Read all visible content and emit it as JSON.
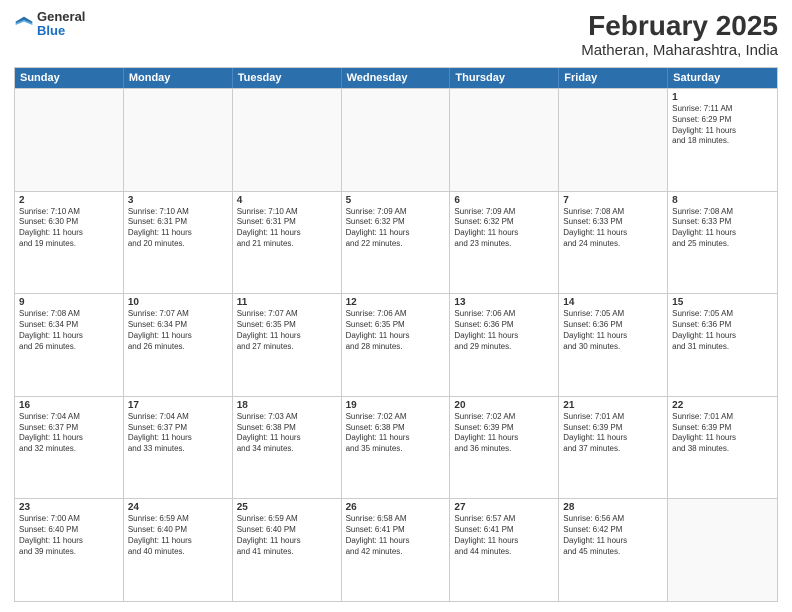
{
  "header": {
    "logo_general": "General",
    "logo_blue": "Blue",
    "main_title": "February 2025",
    "subtitle": "Matheran, Maharashtra, India"
  },
  "calendar": {
    "days_of_week": [
      "Sunday",
      "Monday",
      "Tuesday",
      "Wednesday",
      "Thursday",
      "Friday",
      "Saturday"
    ],
    "rows": [
      [
        {
          "day": "",
          "info": ""
        },
        {
          "day": "",
          "info": ""
        },
        {
          "day": "",
          "info": ""
        },
        {
          "day": "",
          "info": ""
        },
        {
          "day": "",
          "info": ""
        },
        {
          "day": "",
          "info": ""
        },
        {
          "day": "1",
          "info": "Sunrise: 7:11 AM\nSunset: 6:29 PM\nDaylight: 11 hours\nand 18 minutes."
        }
      ],
      [
        {
          "day": "2",
          "info": "Sunrise: 7:10 AM\nSunset: 6:30 PM\nDaylight: 11 hours\nand 19 minutes."
        },
        {
          "day": "3",
          "info": "Sunrise: 7:10 AM\nSunset: 6:31 PM\nDaylight: 11 hours\nand 20 minutes."
        },
        {
          "day": "4",
          "info": "Sunrise: 7:10 AM\nSunset: 6:31 PM\nDaylight: 11 hours\nand 21 minutes."
        },
        {
          "day": "5",
          "info": "Sunrise: 7:09 AM\nSunset: 6:32 PM\nDaylight: 11 hours\nand 22 minutes."
        },
        {
          "day": "6",
          "info": "Sunrise: 7:09 AM\nSunset: 6:32 PM\nDaylight: 11 hours\nand 23 minutes."
        },
        {
          "day": "7",
          "info": "Sunrise: 7:08 AM\nSunset: 6:33 PM\nDaylight: 11 hours\nand 24 minutes."
        },
        {
          "day": "8",
          "info": "Sunrise: 7:08 AM\nSunset: 6:33 PM\nDaylight: 11 hours\nand 25 minutes."
        }
      ],
      [
        {
          "day": "9",
          "info": "Sunrise: 7:08 AM\nSunset: 6:34 PM\nDaylight: 11 hours\nand 26 minutes."
        },
        {
          "day": "10",
          "info": "Sunrise: 7:07 AM\nSunset: 6:34 PM\nDaylight: 11 hours\nand 26 minutes."
        },
        {
          "day": "11",
          "info": "Sunrise: 7:07 AM\nSunset: 6:35 PM\nDaylight: 11 hours\nand 27 minutes."
        },
        {
          "day": "12",
          "info": "Sunrise: 7:06 AM\nSunset: 6:35 PM\nDaylight: 11 hours\nand 28 minutes."
        },
        {
          "day": "13",
          "info": "Sunrise: 7:06 AM\nSunset: 6:36 PM\nDaylight: 11 hours\nand 29 minutes."
        },
        {
          "day": "14",
          "info": "Sunrise: 7:05 AM\nSunset: 6:36 PM\nDaylight: 11 hours\nand 30 minutes."
        },
        {
          "day": "15",
          "info": "Sunrise: 7:05 AM\nSunset: 6:36 PM\nDaylight: 11 hours\nand 31 minutes."
        }
      ],
      [
        {
          "day": "16",
          "info": "Sunrise: 7:04 AM\nSunset: 6:37 PM\nDaylight: 11 hours\nand 32 minutes."
        },
        {
          "day": "17",
          "info": "Sunrise: 7:04 AM\nSunset: 6:37 PM\nDaylight: 11 hours\nand 33 minutes."
        },
        {
          "day": "18",
          "info": "Sunrise: 7:03 AM\nSunset: 6:38 PM\nDaylight: 11 hours\nand 34 minutes."
        },
        {
          "day": "19",
          "info": "Sunrise: 7:02 AM\nSunset: 6:38 PM\nDaylight: 11 hours\nand 35 minutes."
        },
        {
          "day": "20",
          "info": "Sunrise: 7:02 AM\nSunset: 6:39 PM\nDaylight: 11 hours\nand 36 minutes."
        },
        {
          "day": "21",
          "info": "Sunrise: 7:01 AM\nSunset: 6:39 PM\nDaylight: 11 hours\nand 37 minutes."
        },
        {
          "day": "22",
          "info": "Sunrise: 7:01 AM\nSunset: 6:39 PM\nDaylight: 11 hours\nand 38 minutes."
        }
      ],
      [
        {
          "day": "23",
          "info": "Sunrise: 7:00 AM\nSunset: 6:40 PM\nDaylight: 11 hours\nand 39 minutes."
        },
        {
          "day": "24",
          "info": "Sunrise: 6:59 AM\nSunset: 6:40 PM\nDaylight: 11 hours\nand 40 minutes."
        },
        {
          "day": "25",
          "info": "Sunrise: 6:59 AM\nSunset: 6:40 PM\nDaylight: 11 hours\nand 41 minutes."
        },
        {
          "day": "26",
          "info": "Sunrise: 6:58 AM\nSunset: 6:41 PM\nDaylight: 11 hours\nand 42 minutes."
        },
        {
          "day": "27",
          "info": "Sunrise: 6:57 AM\nSunset: 6:41 PM\nDaylight: 11 hours\nand 44 minutes."
        },
        {
          "day": "28",
          "info": "Sunrise: 6:56 AM\nSunset: 6:42 PM\nDaylight: 11 hours\nand 45 minutes."
        },
        {
          "day": "",
          "info": ""
        }
      ]
    ]
  }
}
